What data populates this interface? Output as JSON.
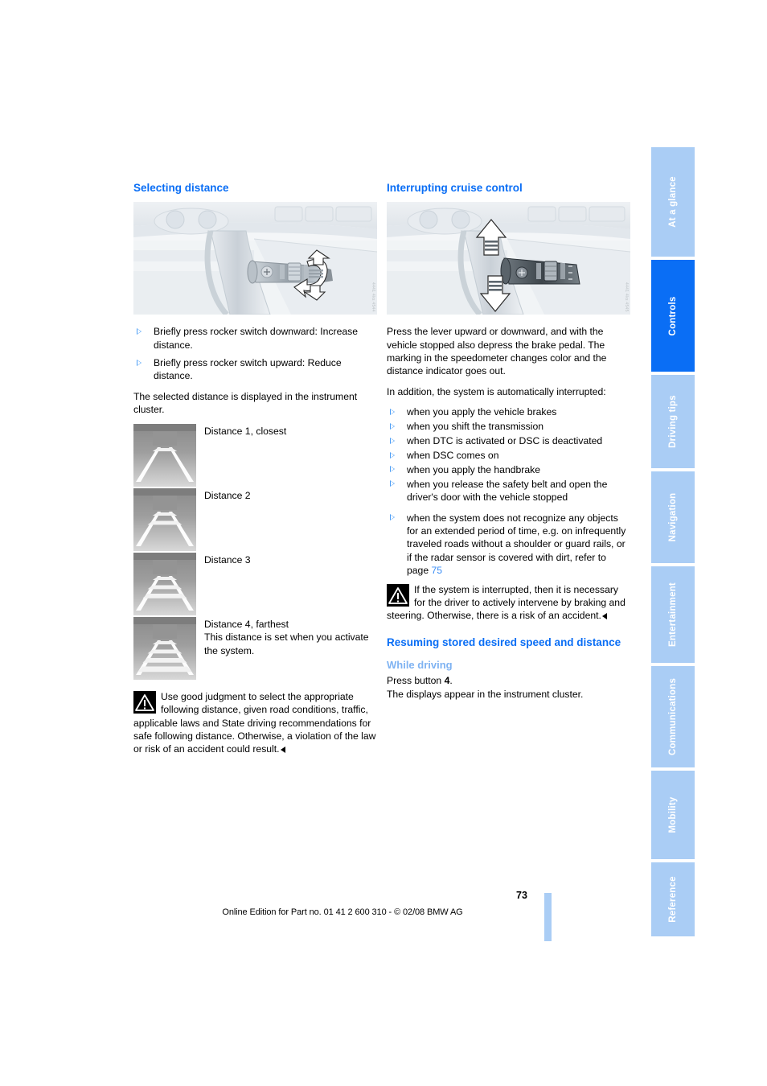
{
  "document": {
    "page_number": "73",
    "footer": "Online Edition for Part no. 01 41 2 600 310 - © 02/08 BMW AG"
  },
  "tabs": [
    {
      "label": "At a glance",
      "active": false
    },
    {
      "label": "Controls",
      "active": true
    },
    {
      "label": "Driving tips",
      "active": false
    },
    {
      "label": "Navigation",
      "active": false
    },
    {
      "label": "Entertainment",
      "active": false
    },
    {
      "label": "Communications",
      "active": false
    },
    {
      "label": "Mobility",
      "active": false
    },
    {
      "label": "Reference",
      "active": false
    }
  ],
  "left_column": {
    "heading": "Selecting distance",
    "figure_code": "4441 4ks 4544",
    "bullets": [
      "Briefly press rocker switch downward: Increase distance.",
      "Briefly press rocker switch upward: Reduce distance."
    ],
    "intro": "The selected distance is displayed in the instrument cluster.",
    "distances": [
      {
        "bars": 1,
        "label": "Distance 1, closest",
        "note": ""
      },
      {
        "bars": 2,
        "label": "Distance 2",
        "note": ""
      },
      {
        "bars": 3,
        "label": "Distance 3",
        "note": ""
      },
      {
        "bars": 4,
        "label": "Distance 4, farthest",
        "note": "This distance is set when you activate the system."
      }
    ],
    "warning": "Use good judgment to select the appropriate following distance, given road conditions, traffic, applicable laws and State driving recommendations for safe following distance. Otherwise, a violation of the law or risk of an accident could result."
  },
  "right_column": {
    "heading": "Interrupting cruise control",
    "figure_code": "4441 4ks 4545",
    "paragraph_1": "Press the lever upward or downward, and with the vehicle stopped also depress the brake pedal. The marking in the speedometer changes color and the distance indicator goes out.",
    "paragraph_2": "In addition, the system is automatically interrupted:",
    "bullets": [
      "when you apply the vehicle brakes",
      "when you shift the transmission",
      "when DTC is activated or DSC is deactivated",
      "when DSC comes on",
      "when you apply the handbrake",
      "when you release the safety belt and open the driver's door with the vehicle stopped"
    ],
    "bullet_last_pre": "when the system does not recognize any objects for an extended period of time, e.g. on infrequently traveled roads without a shoulder or guard rails, or if the radar sensor is covered with dirt, refer to page ",
    "bullet_last_pageref": "75",
    "warning": "If the system is interrupted, then it is necessary for the driver to actively intervene by braking and steering. Otherwise, there is a risk of an accident.",
    "heading_2": "Resuming stored desired speed and distance",
    "subheading": "While driving",
    "press_button_pre": "Press button ",
    "press_button_num": "4",
    "press_button_post": ".",
    "closing": "The displays appear in the instrument cluster."
  },
  "colors": {
    "accent_blue": "#0a6ef5",
    "light_blue": "#7fb3f2",
    "tab_blue": "#aacdf5",
    "pageref_blue": "#3b8ef5"
  }
}
